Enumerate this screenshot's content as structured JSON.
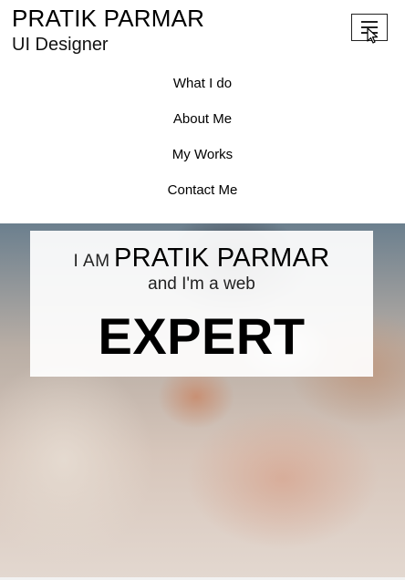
{
  "brand": {
    "name": "PRATIK PARMAR",
    "role": "UI Designer"
  },
  "header": {
    "menu_toggle": {
      "icon": "hamburger-menu-icon"
    }
  },
  "nav": {
    "items": [
      {
        "label": "What I do"
      },
      {
        "label": "About Me"
      },
      {
        "label": "My Works"
      },
      {
        "label": "Contact Me"
      }
    ]
  },
  "hero": {
    "intro": "I AM",
    "name": "PRATIK PARMAR",
    "line2": "and I'm a web",
    "word": "EXPERT"
  },
  "colors": {
    "text": "#000000",
    "background": "#ffffff",
    "card": "#ffffff"
  }
}
